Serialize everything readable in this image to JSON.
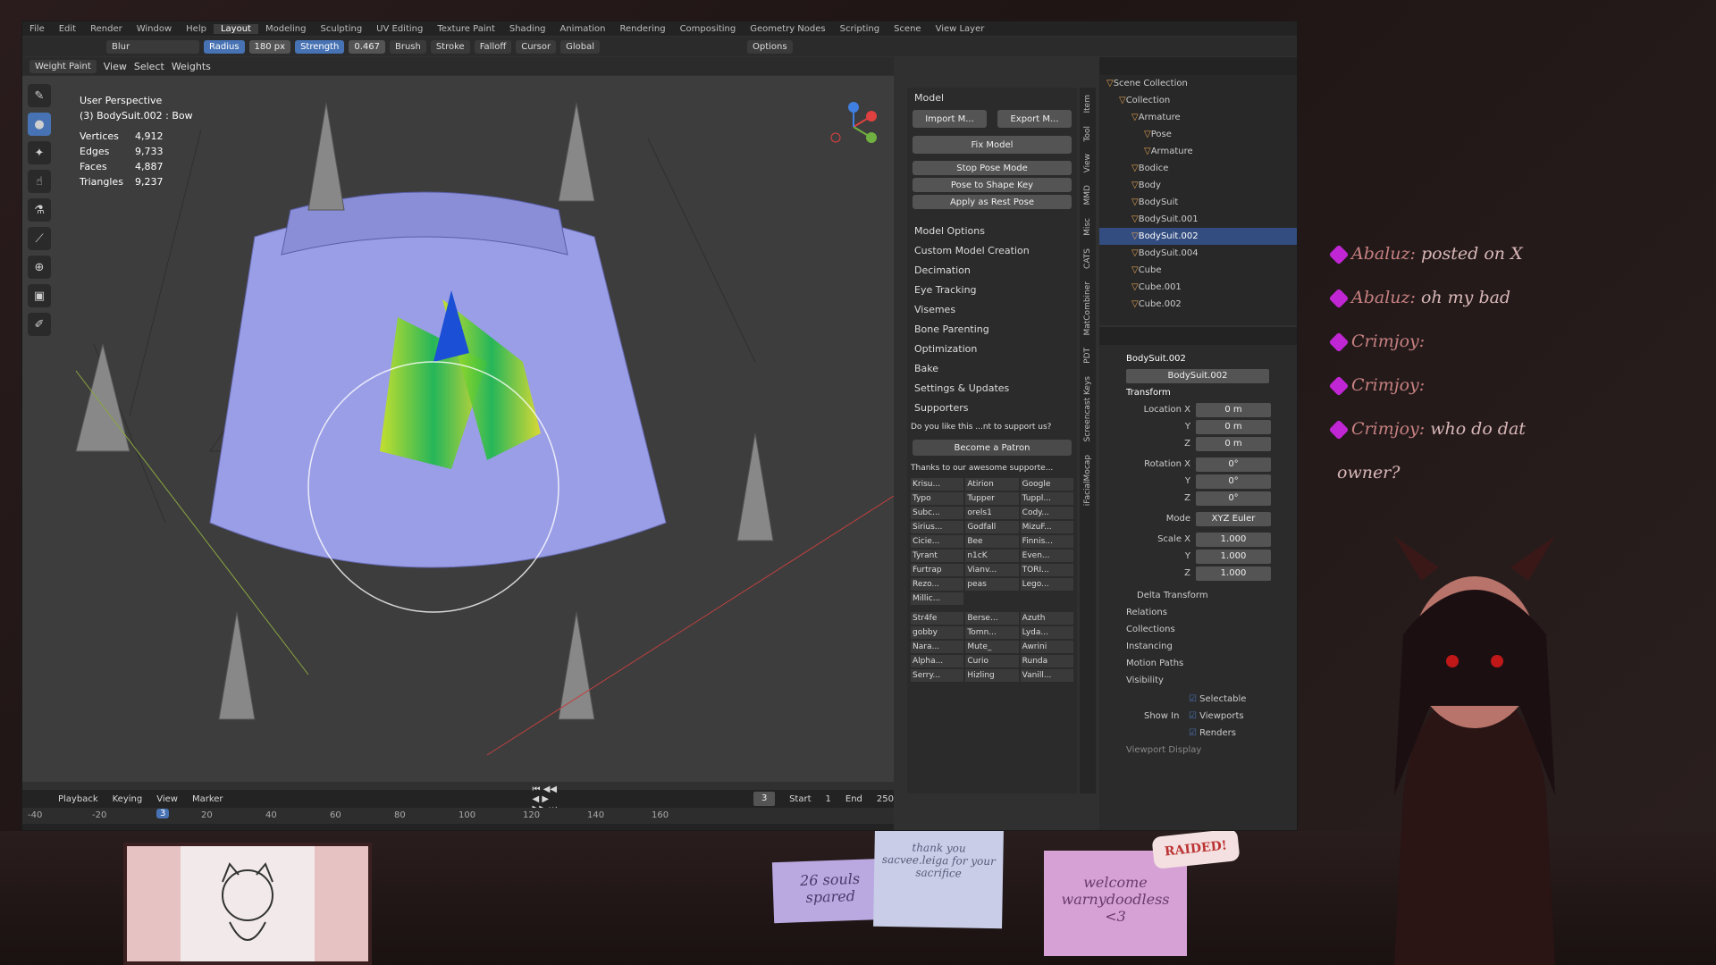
{
  "topmenu": {
    "items": [
      "File",
      "Edit",
      "Render",
      "Window",
      "Help",
      "Layout",
      "Modeling",
      "Sculpting",
      "UV Editing",
      "Texture Paint",
      "Shading",
      "Animation",
      "Rendering",
      "Compositing",
      "Geometry Nodes",
      "Scripting",
      "Scene",
      "View Layer"
    ],
    "active": "Layout"
  },
  "toolsettings": {
    "brush_name": "Blur",
    "radius_label": "Radius",
    "radius_value": "180 px",
    "strength_label": "Strength",
    "strength_value": "0.467",
    "brush_menu": "Brush",
    "stroke_menu": "Stroke",
    "falloff_menu": "Falloff",
    "cursor_menu": "Cursor",
    "orientation": "Global",
    "options_menu": "Options"
  },
  "viewport_header": {
    "mode": "Weight Paint",
    "menus": [
      "View",
      "Select",
      "Weights"
    ]
  },
  "overlay": {
    "perspective": "User Perspective",
    "object": "(3) BodySuit.002 : Bow",
    "stats": [
      {
        "label": "Vertices",
        "value": "4,912"
      },
      {
        "label": "Edges",
        "value": "9,733"
      },
      {
        "label": "Faces",
        "value": "4,887"
      },
      {
        "label": "Triangles",
        "value": "9,237"
      }
    ]
  },
  "npanel": {
    "model_header": "Model",
    "import_label": "Import M...",
    "export_label": "Export M...",
    "fix_model": "Fix Model",
    "stop_pose": "Stop Pose Mode",
    "pose_to_shape": "Pose to Shape Key",
    "apply_rest": "Apply as Rest Pose",
    "sections": [
      "Model Options",
      "Custom Model Creation",
      "Decimation",
      "Eye Tracking",
      "Visemes",
      "Bone Parenting",
      "Optimization",
      "Bake",
      "Settings & Updates",
      "Supporters"
    ],
    "supporters_q": "Do you like this ...nt to support us?",
    "patron": "Become a Patron",
    "thanks": "Thanks to our awesome supporte...",
    "supporters": [
      "Krisu...",
      "Atirion",
      "Google",
      "Typo",
      "Tupper",
      "Tuppl...",
      "Subc...",
      "orels1",
      "Cody...",
      "Sirius...",
      "Godfall",
      "MizuF...",
      "Cicie...",
      "Bee",
      "Finnis...",
      "Tyrant",
      "n1cK",
      "Even...",
      "Furtrap",
      "Vianv...",
      "TORI...",
      "Rezo...",
      "peas",
      "Lego...",
      "Millic..."
    ],
    "supporters2": [
      "Str4fe",
      "Berse...",
      "Azuth",
      "gobby",
      "Tomn...",
      "Lyda...",
      "Nara...",
      "Mute_",
      "Awrini",
      "Alpha...",
      "Curio",
      "Runda",
      "Serry...",
      "Hizling",
      "Vanill..."
    ]
  },
  "vtabs": [
    "Item",
    "Tool",
    "View",
    "MMD",
    "Misc",
    "CATS",
    "MatCombiner",
    "PDT",
    "Screencast Keys",
    "iFacialMocap"
  ],
  "outliner": {
    "rows": [
      {
        "label": "Scene Collection",
        "indent": 0,
        "sel": false
      },
      {
        "label": "Collection",
        "indent": 1,
        "sel": false
      },
      {
        "label": "Armature",
        "indent": 2,
        "sel": false
      },
      {
        "label": "Pose",
        "indent": 3,
        "sel": false
      },
      {
        "label": "Armature",
        "indent": 3,
        "sel": false
      },
      {
        "label": "Bodice",
        "indent": 2,
        "sel": false
      },
      {
        "label": "Body",
        "indent": 2,
        "sel": false
      },
      {
        "label": "BodySuit",
        "indent": 2,
        "sel": false
      },
      {
        "label": "BodySuit.001",
        "indent": 2,
        "sel": false
      },
      {
        "label": "BodySuit.002",
        "indent": 2,
        "sel": true
      },
      {
        "label": "BodySuit.004",
        "indent": 2,
        "sel": false
      },
      {
        "label": "Cube",
        "indent": 2,
        "sel": false
      },
      {
        "label": "Cube.001",
        "indent": 2,
        "sel": false
      },
      {
        "label": "Cube.002",
        "indent": 2,
        "sel": false
      }
    ]
  },
  "props": {
    "object_name": "BodySuit.002",
    "data_name": "BodySuit.002",
    "transform": "Transform",
    "location_label": "Location X",
    "loc": [
      "0 m",
      "0 m",
      "0 m"
    ],
    "rotation_label": "Rotation X",
    "rot": [
      "0°",
      "0°",
      "0°"
    ],
    "mode_label": "Mode",
    "mode_value": "XYZ Euler",
    "scale_label": "Scale X",
    "scale": [
      "1.000",
      "1.000",
      "1.000"
    ],
    "y_label": "Y",
    "z_label": "Z",
    "sections": [
      "Delta Transform",
      "Relations",
      "Collections",
      "Instancing",
      "Motion Paths",
      "Visibility"
    ],
    "selectable": "Selectable",
    "show_in": "Show In",
    "viewports": "Viewports",
    "renders": "Renders",
    "viewport_display": "Viewport Display"
  },
  "timeline": {
    "menus": [
      "Playback",
      "Keying",
      "View",
      "Marker"
    ],
    "current_frame": "3",
    "start_label": "Start",
    "start": "1",
    "end_label": "End",
    "end": "250",
    "ticks": [
      "-40",
      "-20",
      "20",
      "40",
      "60",
      "80",
      "100",
      "120",
      "140",
      "160"
    ],
    "playhead": "3"
  },
  "chat": [
    {
      "name": "Abaluz:",
      "msg": "posted on X"
    },
    {
      "name": "Abaluz:",
      "msg": "oh my bad"
    },
    {
      "name": "Crimjoy:",
      "msg": ""
    },
    {
      "name": "Crimjoy:",
      "msg": ""
    },
    {
      "name": "Crimjoy:",
      "msg": "who do dat"
    },
    {
      "name": "",
      "msg": "owner?"
    }
  ],
  "stickies": {
    "souls": "26 souls spared",
    "thanks": "thank you sacvee.leiga for your sacrifice",
    "welcome": "welcome warnydoodless <3",
    "raid": "RAIDED!"
  },
  "colors": {
    "blender_bg": "#303030",
    "accent": "#4772b3",
    "mesh": "#9a9ee6",
    "selected": "#334d80"
  }
}
